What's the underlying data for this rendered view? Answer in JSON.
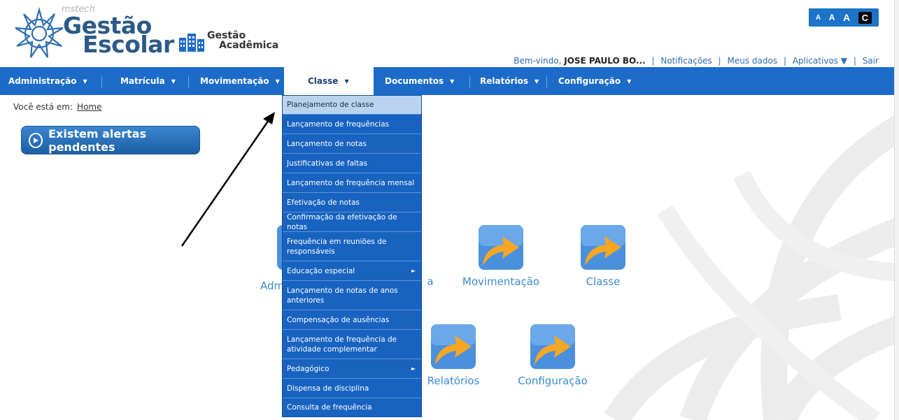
{
  "header": {
    "brand_small": "mstech",
    "brand_line1": "Gestão",
    "brand_line2": "Escolar",
    "app_line1": "Gestão",
    "app_line2": "Acadêmica"
  },
  "accessibility": {
    "a_small": "A",
    "a_medium": "A",
    "a_large": "A",
    "contrast": "C"
  },
  "userbar": {
    "welcome_prefix": "Bem-vindo,",
    "user_name": "JOSE PAULO BO...",
    "notifications": "Notificações",
    "my_data": "Meus dados",
    "apps": "Aplicativos ▼",
    "logout": "Sair"
  },
  "nav": {
    "items": [
      {
        "label": "Administração"
      },
      {
        "label": "Matrícula"
      },
      {
        "label": "Movimentação"
      },
      {
        "label": "Classe"
      },
      {
        "label": "Documentos"
      },
      {
        "label": "Relatórios"
      },
      {
        "label": "Configuração"
      }
    ]
  },
  "breadcrumb": {
    "prefix": "Você está em:",
    "home": "Home"
  },
  "alert": {
    "label": "Existem alertas pendentes"
  },
  "tiles": {
    "admin_partial": "Adm",
    "matricula_partial": "a",
    "movimentacao": "Movimentação",
    "classe": "Classe",
    "relatorios": "Relatórios",
    "configuracao": "Configuração"
  },
  "dropdown": {
    "items": [
      {
        "label": "Planejamento de classe"
      },
      {
        "label": "Lançamento de frequências"
      },
      {
        "label": "Lançamento de notas"
      },
      {
        "label": "Justificativas de faltas"
      },
      {
        "label": "Lançamento de frequência mensal"
      },
      {
        "label": "Efetivação de notas"
      },
      {
        "label": "Confirmação da efetivação de notas"
      },
      {
        "label": "Frequência em reuniões de responsáveis"
      },
      {
        "label": "Educação especial"
      },
      {
        "label": "Lançamento de notas de anos anteriores"
      },
      {
        "label": "Compensação de ausências"
      },
      {
        "label": "Lançamento de frequência de atividade complementar"
      },
      {
        "label": "Pedagógico"
      },
      {
        "label": "Dispensa de disciplina"
      },
      {
        "label": "Consulta de frequência"
      }
    ]
  },
  "colors": {
    "nav_bg": "#1c6bc9",
    "dropdown_bg": "#1863c0",
    "brand": "#2b5a87",
    "link": "#2a6db5"
  }
}
